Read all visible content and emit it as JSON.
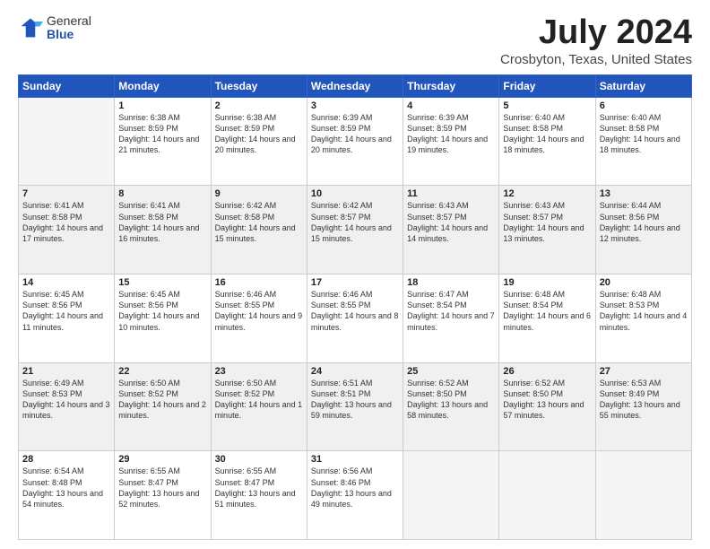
{
  "logo": {
    "general": "General",
    "blue": "Blue"
  },
  "header": {
    "title": "July 2024",
    "subtitle": "Crosbyton, Texas, United States"
  },
  "days_of_week": [
    "Sunday",
    "Monday",
    "Tuesday",
    "Wednesday",
    "Thursday",
    "Friday",
    "Saturday"
  ],
  "weeks": [
    {
      "shade": "white",
      "days": [
        {
          "num": "",
          "empty": true
        },
        {
          "num": "1",
          "sunrise": "Sunrise: 6:38 AM",
          "sunset": "Sunset: 8:59 PM",
          "daylight": "Daylight: 14 hours and 21 minutes."
        },
        {
          "num": "2",
          "sunrise": "Sunrise: 6:38 AM",
          "sunset": "Sunset: 8:59 PM",
          "daylight": "Daylight: 14 hours and 20 minutes."
        },
        {
          "num": "3",
          "sunrise": "Sunrise: 6:39 AM",
          "sunset": "Sunset: 8:59 PM",
          "daylight": "Daylight: 14 hours and 20 minutes."
        },
        {
          "num": "4",
          "sunrise": "Sunrise: 6:39 AM",
          "sunset": "Sunset: 8:59 PM",
          "daylight": "Daylight: 14 hours and 19 minutes."
        },
        {
          "num": "5",
          "sunrise": "Sunrise: 6:40 AM",
          "sunset": "Sunset: 8:58 PM",
          "daylight": "Daylight: 14 hours and 18 minutes."
        },
        {
          "num": "6",
          "sunrise": "Sunrise: 6:40 AM",
          "sunset": "Sunset: 8:58 PM",
          "daylight": "Daylight: 14 hours and 18 minutes."
        }
      ]
    },
    {
      "shade": "gray",
      "days": [
        {
          "num": "7",
          "sunrise": "Sunrise: 6:41 AM",
          "sunset": "Sunset: 8:58 PM",
          "daylight": "Daylight: 14 hours and 17 minutes."
        },
        {
          "num": "8",
          "sunrise": "Sunrise: 6:41 AM",
          "sunset": "Sunset: 8:58 PM",
          "daylight": "Daylight: 14 hours and 16 minutes."
        },
        {
          "num": "9",
          "sunrise": "Sunrise: 6:42 AM",
          "sunset": "Sunset: 8:58 PM",
          "daylight": "Daylight: 14 hours and 15 minutes."
        },
        {
          "num": "10",
          "sunrise": "Sunrise: 6:42 AM",
          "sunset": "Sunset: 8:57 PM",
          "daylight": "Daylight: 14 hours and 15 minutes."
        },
        {
          "num": "11",
          "sunrise": "Sunrise: 6:43 AM",
          "sunset": "Sunset: 8:57 PM",
          "daylight": "Daylight: 14 hours and 14 minutes."
        },
        {
          "num": "12",
          "sunrise": "Sunrise: 6:43 AM",
          "sunset": "Sunset: 8:57 PM",
          "daylight": "Daylight: 14 hours and 13 minutes."
        },
        {
          "num": "13",
          "sunrise": "Sunrise: 6:44 AM",
          "sunset": "Sunset: 8:56 PM",
          "daylight": "Daylight: 14 hours and 12 minutes."
        }
      ]
    },
    {
      "shade": "white",
      "days": [
        {
          "num": "14",
          "sunrise": "Sunrise: 6:45 AM",
          "sunset": "Sunset: 8:56 PM",
          "daylight": "Daylight: 14 hours and 11 minutes."
        },
        {
          "num": "15",
          "sunrise": "Sunrise: 6:45 AM",
          "sunset": "Sunset: 8:56 PM",
          "daylight": "Daylight: 14 hours and 10 minutes."
        },
        {
          "num": "16",
          "sunrise": "Sunrise: 6:46 AM",
          "sunset": "Sunset: 8:55 PM",
          "daylight": "Daylight: 14 hours and 9 minutes."
        },
        {
          "num": "17",
          "sunrise": "Sunrise: 6:46 AM",
          "sunset": "Sunset: 8:55 PM",
          "daylight": "Daylight: 14 hours and 8 minutes."
        },
        {
          "num": "18",
          "sunrise": "Sunrise: 6:47 AM",
          "sunset": "Sunset: 8:54 PM",
          "daylight": "Daylight: 14 hours and 7 minutes."
        },
        {
          "num": "19",
          "sunrise": "Sunrise: 6:48 AM",
          "sunset": "Sunset: 8:54 PM",
          "daylight": "Daylight: 14 hours and 6 minutes."
        },
        {
          "num": "20",
          "sunrise": "Sunrise: 6:48 AM",
          "sunset": "Sunset: 8:53 PM",
          "daylight": "Daylight: 14 hours and 4 minutes."
        }
      ]
    },
    {
      "shade": "gray",
      "days": [
        {
          "num": "21",
          "sunrise": "Sunrise: 6:49 AM",
          "sunset": "Sunset: 8:53 PM",
          "daylight": "Daylight: 14 hours and 3 minutes."
        },
        {
          "num": "22",
          "sunrise": "Sunrise: 6:50 AM",
          "sunset": "Sunset: 8:52 PM",
          "daylight": "Daylight: 14 hours and 2 minutes."
        },
        {
          "num": "23",
          "sunrise": "Sunrise: 6:50 AM",
          "sunset": "Sunset: 8:52 PM",
          "daylight": "Daylight: 14 hours and 1 minute."
        },
        {
          "num": "24",
          "sunrise": "Sunrise: 6:51 AM",
          "sunset": "Sunset: 8:51 PM",
          "daylight": "Daylight: 13 hours and 59 minutes."
        },
        {
          "num": "25",
          "sunrise": "Sunrise: 6:52 AM",
          "sunset": "Sunset: 8:50 PM",
          "daylight": "Daylight: 13 hours and 58 minutes."
        },
        {
          "num": "26",
          "sunrise": "Sunrise: 6:52 AM",
          "sunset": "Sunset: 8:50 PM",
          "daylight": "Daylight: 13 hours and 57 minutes."
        },
        {
          "num": "27",
          "sunrise": "Sunrise: 6:53 AM",
          "sunset": "Sunset: 8:49 PM",
          "daylight": "Daylight: 13 hours and 55 minutes."
        }
      ]
    },
    {
      "shade": "white",
      "days": [
        {
          "num": "28",
          "sunrise": "Sunrise: 6:54 AM",
          "sunset": "Sunset: 8:48 PM",
          "daylight": "Daylight: 13 hours and 54 minutes."
        },
        {
          "num": "29",
          "sunrise": "Sunrise: 6:55 AM",
          "sunset": "Sunset: 8:47 PM",
          "daylight": "Daylight: 13 hours and 52 minutes."
        },
        {
          "num": "30",
          "sunrise": "Sunrise: 6:55 AM",
          "sunset": "Sunset: 8:47 PM",
          "daylight": "Daylight: 13 hours and 51 minutes."
        },
        {
          "num": "31",
          "sunrise": "Sunrise: 6:56 AM",
          "sunset": "Sunset: 8:46 PM",
          "daylight": "Daylight: 13 hours and 49 minutes."
        },
        {
          "num": "",
          "empty": true
        },
        {
          "num": "",
          "empty": true
        },
        {
          "num": "",
          "empty": true
        }
      ]
    }
  ]
}
